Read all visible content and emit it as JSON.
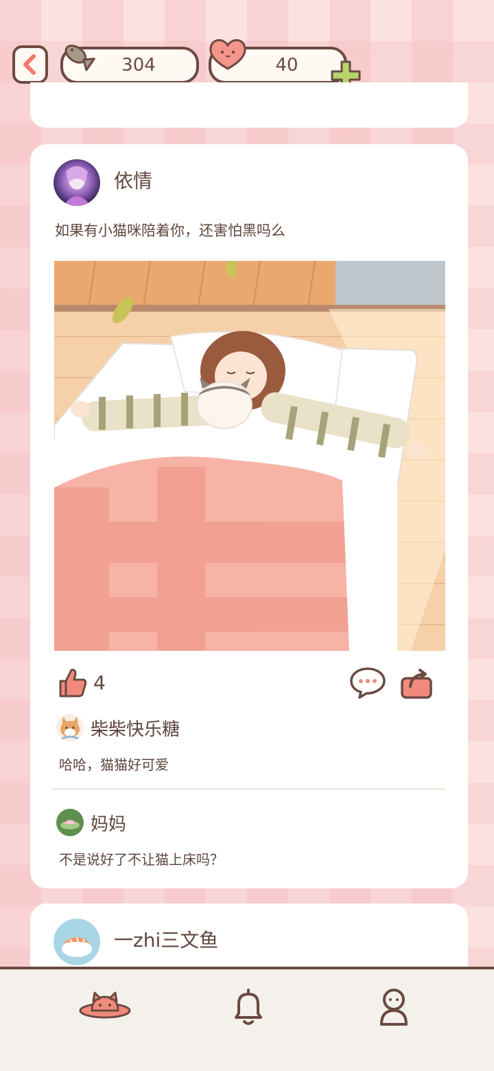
{
  "header": {
    "fish_count": "304",
    "heart_count": "40"
  },
  "post": {
    "author": "依情",
    "text": "如果有小猫咪陪着你，还害怕黑吗么",
    "likes": "4",
    "comments": [
      {
        "name": "柴柴快乐糖",
        "text": "哈哈，猫猫好可爱"
      },
      {
        "name": "妈妈",
        "text": "不是说好了不让猫上床吗？"
      }
    ]
  },
  "next_post": {
    "author": "一zhi三文鱼"
  },
  "colors": {
    "accent": "#f08a7c",
    "outline": "#6b4a41",
    "plus": "#b6d46a"
  },
  "icons": [
    "back-icon",
    "fish-icon",
    "heart-icon",
    "plus-icon",
    "like-icon",
    "comment-icon",
    "share-icon",
    "cat-planet-icon",
    "bell-icon",
    "profile-icon"
  ]
}
